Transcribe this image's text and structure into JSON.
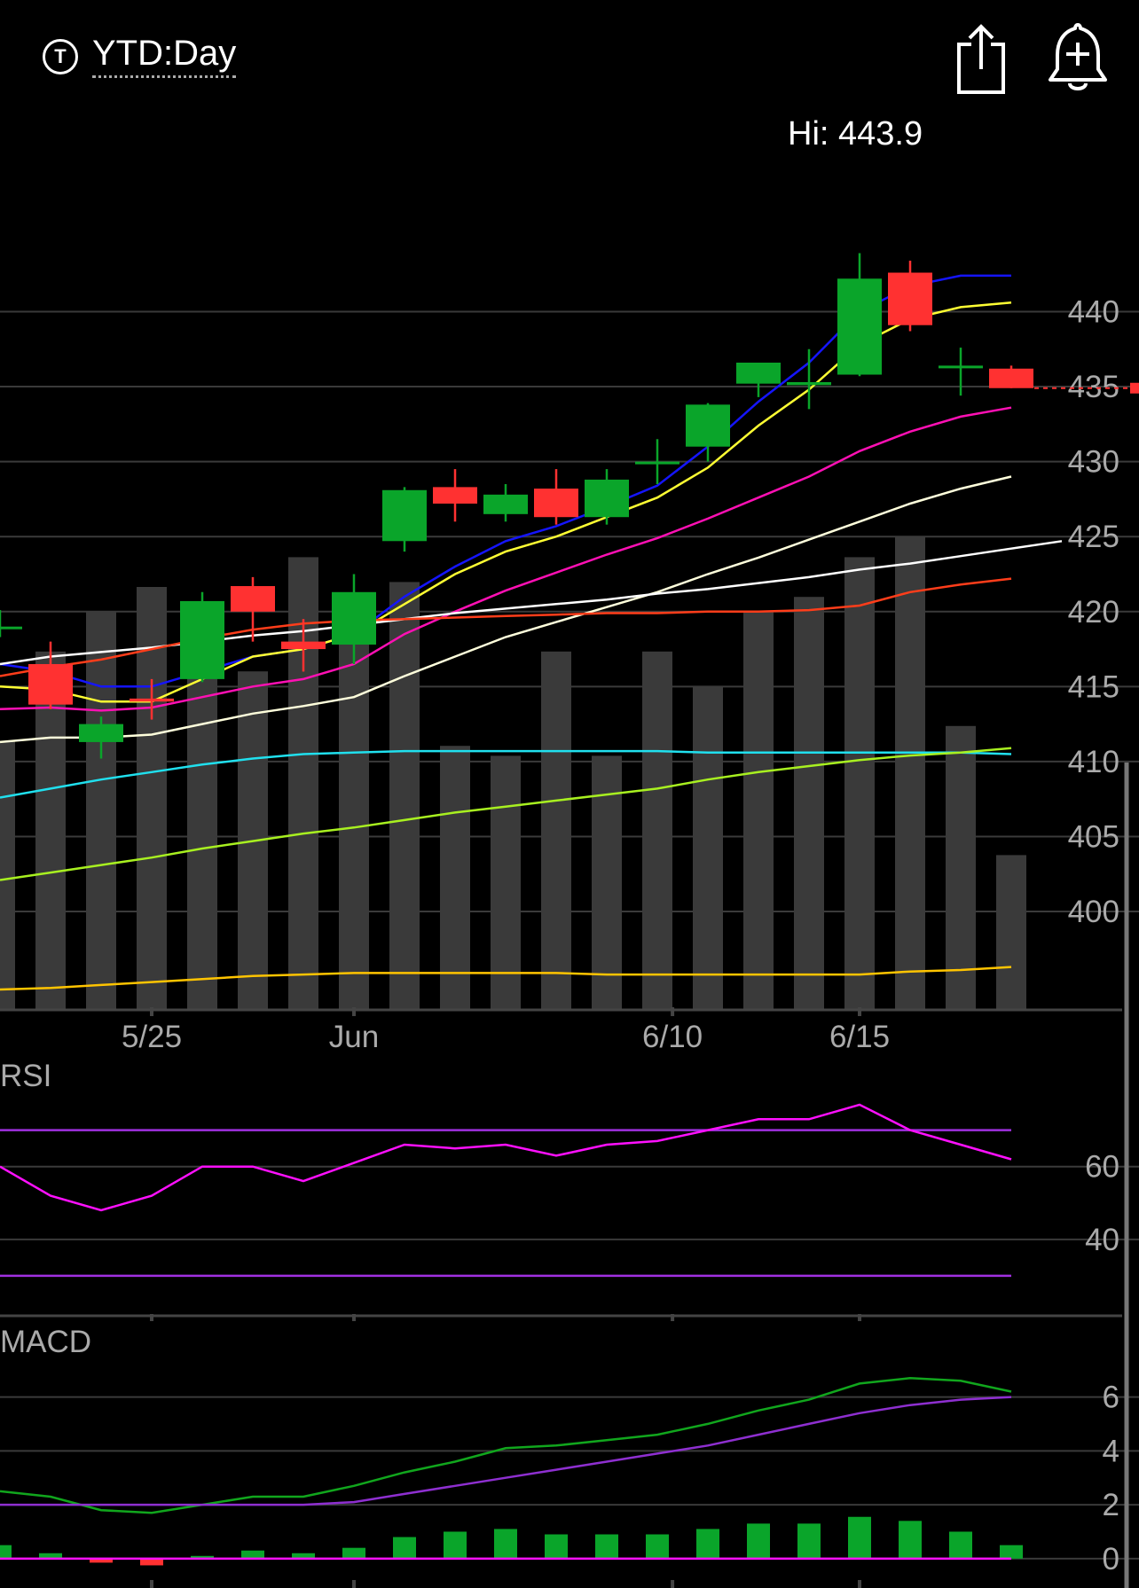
{
  "header": {
    "ticker_icon": "T",
    "title": "YTD:Day",
    "share_icon": "share-icon",
    "alert_icon": "bell-plus-icon"
  },
  "hi_label": "Hi: 443.9",
  "colors": {
    "up": "#0aa52a",
    "down": "#ff3131",
    "volume": "#3a3a3a",
    "grid": "#3a3a3a",
    "ma_blue": "#1515ff",
    "ma_yellow": "#ffff33",
    "ma_pink": "#ff10b4",
    "ma_cream": "#ffffdc",
    "ma_white": "#ffffff",
    "ma_orange": "#ff3d1a",
    "ma_cyan": "#20e0ee",
    "ma_lime": "#a8f020",
    "ma_gold": "#ffc400",
    "rsi": "#ff10ff",
    "rsi_band": "#a030e0",
    "macd": "#11a61d",
    "signal": "#8e2fd0"
  },
  "chart_data": [
    {
      "type": "candlestick",
      "name": "price",
      "ylim": [
        393.5,
        446
      ],
      "yticks": [
        "440",
        "435",
        "430",
        "425",
        "420",
        "415",
        "410",
        "405",
        "400"
      ],
      "ytick_values": [
        440,
        435,
        430,
        425,
        420,
        415,
        410,
        405,
        400
      ],
      "xlabels": [
        {
          "label": "5/25",
          "index": 3
        },
        {
          "label": "Jun",
          "index": 7
        },
        {
          "label": "6/10",
          "index": 13.3
        },
        {
          "label": "6/15",
          "index": 17
        }
      ],
      "candles": [
        {
          "o": 418.9,
          "h": 420.1,
          "l": 418.3,
          "c": 419.0
        },
        {
          "o": 416.5,
          "h": 418.0,
          "l": 413.5,
          "c": 413.8
        },
        {
          "o": 411.3,
          "h": 413.0,
          "l": 410.2,
          "c": 412.5
        },
        {
          "o": 414.2,
          "h": 415.5,
          "l": 412.8,
          "c": 414.0
        },
        {
          "o": 415.5,
          "h": 421.3,
          "l": 415.3,
          "c": 420.7
        },
        {
          "o": 421.7,
          "h": 422.3,
          "l": 418.0,
          "c": 420.0
        },
        {
          "o": 418.0,
          "h": 419.5,
          "l": 416.0,
          "c": 417.5
        },
        {
          "o": 417.8,
          "h": 422.5,
          "l": 416.5,
          "c": 421.3
        },
        {
          "o": 424.7,
          "h": 428.3,
          "l": 424.0,
          "c": 428.1
        },
        {
          "o": 428.3,
          "h": 429.5,
          "l": 426.0,
          "c": 427.2
        },
        {
          "o": 426.5,
          "h": 428.5,
          "l": 426.0,
          "c": 427.8
        },
        {
          "o": 428.2,
          "h": 429.5,
          "l": 425.8,
          "c": 426.3
        },
        {
          "o": 426.3,
          "h": 429.5,
          "l": 425.8,
          "c": 428.8
        },
        {
          "o": 430.0,
          "h": 431.5,
          "l": 428.5,
          "c": 430.0
        },
        {
          "o": 431.0,
          "h": 433.9,
          "l": 430.0,
          "c": 433.8
        },
        {
          "o": 435.2,
          "h": 436.4,
          "l": 434.3,
          "c": 436.6
        },
        {
          "o": 435.1,
          "h": 437.5,
          "l": 433.5,
          "c": 435.3
        },
        {
          "o": 435.8,
          "h": 443.9,
          "l": 435.7,
          "c": 442.2
        },
        {
          "o": 442.6,
          "h": 443.4,
          "l": 438.7,
          "c": 439.1
        },
        {
          "o": 436.4,
          "h": 437.6,
          "l": 434.4,
          "c": 436.4
        },
        {
          "o": 436.2,
          "h": 436.4,
          "l": 434.9,
          "c": 434.9
        }
      ],
      "last_price": 434.9,
      "volume": [
        0.54,
        0.72,
        0.8,
        0.85,
        0.82,
        0.68,
        0.91,
        0.78,
        0.86,
        0.53,
        0.51,
        0.72,
        0.51,
        0.72,
        0.65,
        0.8,
        0.83,
        0.91,
        0.95,
        0.57,
        0.31
      ],
      "overlays": [
        {
          "color": "ma_blue",
          "values": [
            416.5,
            416.0,
            415.0,
            415.0,
            416.0,
            417.0,
            417.5,
            418.5,
            421.0,
            423.0,
            424.7,
            425.7,
            427.0,
            428.4,
            431.0,
            434.0,
            436.6,
            440.0,
            441.7,
            442.4,
            442.4
          ]
        },
        {
          "color": "ma_yellow",
          "values": [
            415.0,
            414.8,
            414.0,
            414.0,
            415.5,
            417.0,
            417.5,
            418.5,
            420.5,
            422.5,
            424.0,
            425.0,
            426.3,
            427.6,
            429.6,
            432.4,
            434.8,
            437.8,
            439.5,
            440.3,
            440.6
          ]
        },
        {
          "color": "ma_pink",
          "values": [
            413.5,
            413.6,
            413.4,
            413.6,
            414.3,
            415.0,
            415.5,
            416.5,
            418.5,
            420.0,
            421.4,
            422.6,
            423.8,
            424.9,
            426.2,
            427.6,
            429.0,
            430.7,
            432.0,
            433.0,
            433.6
          ]
        },
        {
          "color": "ma_cream",
          "values": [
            411.3,
            411.6,
            411.6,
            411.8,
            412.5,
            413.2,
            413.7,
            414.3,
            415.7,
            417.0,
            418.3,
            419.3,
            420.3,
            421.3,
            422.5,
            423.6,
            424.8,
            426.0,
            427.2,
            428.2,
            429.0
          ]
        },
        {
          "color": "ma_white",
          "values": [
            416.5,
            417.0,
            417.3,
            417.6,
            418.0,
            418.4,
            418.7,
            419.1,
            419.5,
            419.9,
            420.2,
            420.5,
            420.8,
            421.2,
            421.5,
            421.9,
            422.3,
            422.8,
            423.2,
            423.7,
            424.2,
            424.7
          ]
        },
        {
          "color": "ma_orange",
          "values": [
            415.7,
            416.3,
            416.8,
            417.5,
            418.2,
            418.8,
            419.2,
            419.4,
            419.5,
            419.6,
            419.7,
            419.8,
            419.9,
            419.9,
            420.0,
            420.0,
            420.1,
            420.4,
            421.3,
            421.8,
            422.2
          ]
        },
        {
          "color": "ma_cyan",
          "values": [
            407.6,
            408.2,
            408.8,
            409.3,
            409.8,
            410.2,
            410.5,
            410.6,
            410.7,
            410.7,
            410.7,
            410.7,
            410.7,
            410.7,
            410.6,
            410.6,
            410.6,
            410.6,
            410.6,
            410.6,
            410.5
          ]
        },
        {
          "color": "ma_lime",
          "values": [
            402.1,
            402.6,
            403.1,
            403.6,
            404.2,
            404.7,
            405.2,
            405.6,
            406.1,
            406.6,
            407.0,
            407.4,
            407.8,
            408.2,
            408.8,
            409.3,
            409.7,
            410.1,
            410.4,
            410.6,
            410.9
          ]
        },
        {
          "color": "ma_gold",
          "values": [
            394.8,
            394.9,
            395.1,
            395.3,
            395.5,
            395.7,
            395.8,
            395.9,
            395.9,
            395.9,
            395.9,
            395.9,
            395.8,
            395.8,
            395.8,
            395.8,
            395.8,
            395.8,
            396.0,
            396.1,
            396.3
          ]
        }
      ]
    },
    {
      "type": "line",
      "name": "RSI",
      "title": "RSI",
      "ylim": [
        20,
        85
      ],
      "yticks": [
        "60",
        "40"
      ],
      "ytick_values": [
        60,
        40
      ],
      "bands": [
        70,
        30
      ],
      "values": [
        60,
        52,
        48,
        52,
        60,
        60,
        56,
        61,
        66,
        65,
        66,
        63,
        66,
        67,
        70,
        73,
        73,
        77,
        70,
        66,
        62
      ]
    },
    {
      "type": "bar",
      "name": "MACD",
      "title": "MACD",
      "ylim": [
        -0.4,
        7.5
      ],
      "yticks": [
        "6",
        "4",
        "2",
        "0"
      ],
      "ytick_values": [
        6,
        4,
        2,
        0
      ],
      "macd": [
        2.5,
        2.3,
        1.8,
        1.7,
        2.0,
        2.3,
        2.3,
        2.7,
        3.2,
        3.6,
        4.1,
        4.2,
        4.4,
        4.6,
        5.0,
        5.5,
        5.9,
        6.5,
        6.7,
        6.6,
        6.2
      ],
      "signal": [
        2.0,
        2.0,
        2.0,
        2.0,
        2.0,
        2.0,
        2.0,
        2.1,
        2.4,
        2.7,
        3.0,
        3.3,
        3.6,
        3.9,
        4.2,
        4.6,
        5.0,
        5.4,
        5.7,
        5.9,
        6.0
      ],
      "histogram": [
        0.5,
        0.2,
        -0.15,
        -0.25,
        0.1,
        0.3,
        0.2,
        0.4,
        0.8,
        1.0,
        1.1,
        0.9,
        0.9,
        0.9,
        1.1,
        1.3,
        1.3,
        1.55,
        1.4,
        1.0,
        0.5
      ]
    }
  ]
}
